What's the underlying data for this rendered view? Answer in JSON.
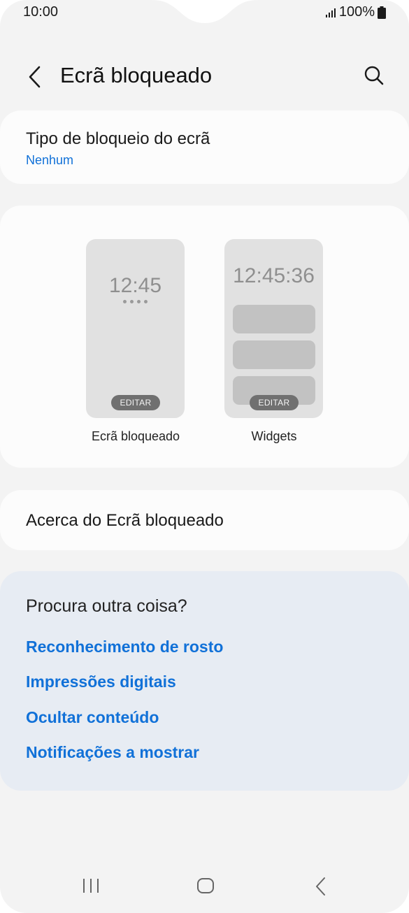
{
  "status_bar": {
    "time": "10:00",
    "battery": "100%"
  },
  "header": {
    "title": "Ecrã bloqueado"
  },
  "lock_type": {
    "title": "Tipo de bloqueio do ecrã",
    "value": "Nenhum"
  },
  "previews": {
    "lock_screen": {
      "clock": "12:45",
      "edit_label": "EDITAR",
      "label": "Ecrã bloqueado"
    },
    "widgets": {
      "clock": "12:45:36",
      "edit_label": "EDITAR",
      "label": "Widgets"
    }
  },
  "about": {
    "title": "Acerca do Ecrã bloqueado"
  },
  "suggestions": {
    "title": "Procura outra coisa?",
    "links": [
      "Reconhecimento de rosto",
      "Impressões digitais",
      "Ocultar conteúdo",
      "Notificações a mostrar"
    ]
  },
  "colors": {
    "accent": "#1171d8",
    "background": "#f3f3f3",
    "card": "#fcfcfc",
    "suggestion_card": "#e7ecf3"
  },
  "icons": {
    "back": "chevron-left-icon",
    "search": "search-icon",
    "nav_recent": "recent-apps-icon",
    "nav_home": "home-icon",
    "nav_back": "back-icon"
  }
}
